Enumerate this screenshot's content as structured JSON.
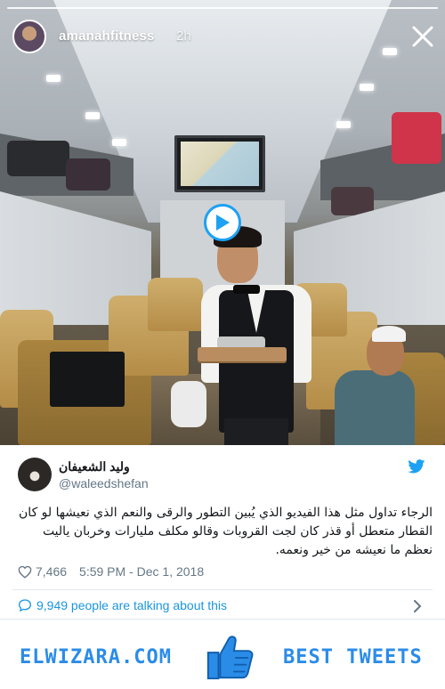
{
  "story": {
    "username": "amanahfitness",
    "time_ago": "2h"
  },
  "tweet": {
    "author_name": "وليد الشعيفان",
    "author_handle": "@waleedshefan",
    "text": "الرجاء تداول مثل هذا الفيديو الذي يُبين التطور والرقى والنعم الذي نعيشها لو كان القطار متعطل أو قذر كان لجت القروبات وقالو مكلف مليارات وخربان ياليت نعظم ما نعيشه من خير ونعمه.",
    "likes": "7,466",
    "timestamp": "5:59 PM - Dec 1, 2018",
    "talking": "9,949 people are talking about this"
  },
  "branding": {
    "left": "ELWIZARA.COM",
    "right": "BEST TWEETS"
  },
  "colors": {
    "twitter_blue": "#1da1f2",
    "link_blue": "#1b95e0",
    "brand_blue": "#2b8ce8",
    "muted_text": "#657786"
  },
  "icons": {
    "close": "close-icon",
    "play": "play-icon",
    "twitter": "twitter-bird-icon",
    "like": "heart-icon",
    "reply": "speech-bubble-icon",
    "more": "chevron-right-icon",
    "thumbs_up": "thumbs-up-icon"
  }
}
